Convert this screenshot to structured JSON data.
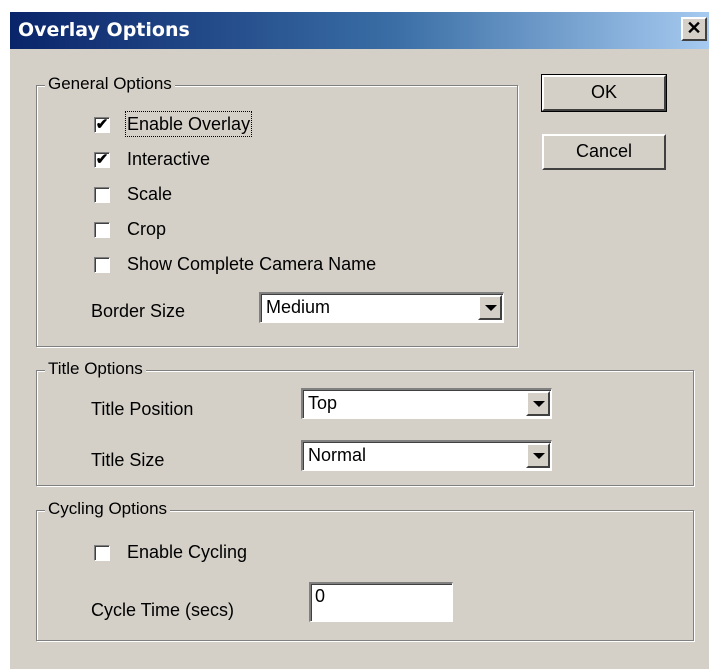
{
  "window": {
    "title": "Overlay Options",
    "close_glyph": "✕"
  },
  "general": {
    "legend": "General Options",
    "checkboxes": [
      {
        "label": "Enable Overlay",
        "checked": true
      },
      {
        "label": "Interactive",
        "checked": true
      },
      {
        "label": "Scale",
        "checked": false
      },
      {
        "label": "Crop",
        "checked": false
      },
      {
        "label": "Show Complete Camera Name",
        "checked": false
      }
    ],
    "border_size_label": "Border Size",
    "border_size_value": "Medium"
  },
  "title_options": {
    "legend": "Title Options",
    "position_label": "Title Position",
    "position_value": "Top",
    "size_label": "Title Size",
    "size_value": "Normal"
  },
  "cycling": {
    "legend": "Cycling Options",
    "enable_label": "Enable Cycling",
    "enable_checked": false,
    "cycle_time_label": "Cycle Time (secs)",
    "cycle_time_value": "0"
  },
  "buttons": {
    "ok": "OK",
    "cancel": "Cancel"
  },
  "check_glyph": "✔",
  "colors": {
    "face": "#d4d0c8",
    "titlebar_start": "#0a246a",
    "titlebar_end": "#a6caf0"
  }
}
